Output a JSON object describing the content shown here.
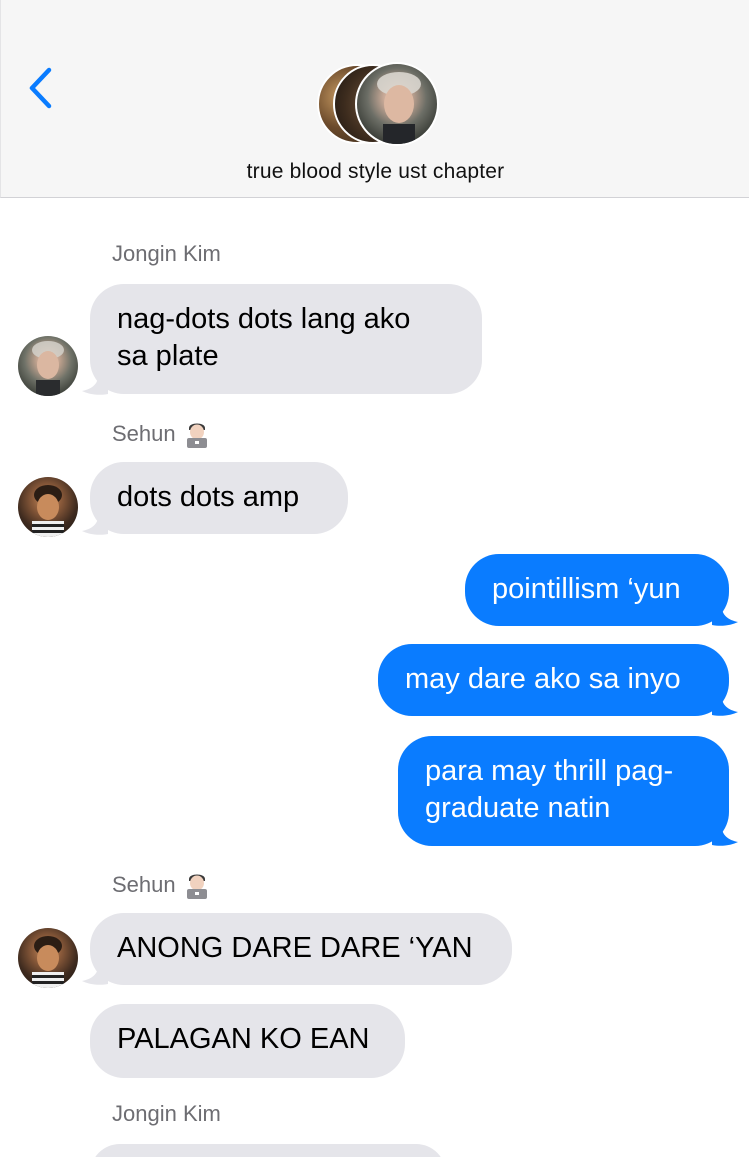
{
  "header": {
    "back_icon": "chevron-left-icon",
    "group_title": "true blood style ust chapter"
  },
  "colors": {
    "accent": "#0a7cff",
    "incoming_bubble": "#e5e5ea",
    "header_bg": "#f6f6f6"
  },
  "messages": [
    {
      "sender": "Jongin Kim",
      "sender_emoji": "",
      "direction": "incoming",
      "text": "nag-dots dots lang ako\nsa plate"
    },
    {
      "sender": "Sehun",
      "sender_emoji": "man-technologist-emoji",
      "direction": "incoming",
      "text": "dots dots amp"
    },
    {
      "sender": "",
      "direction": "outgoing",
      "text": "pointillism ‘yun"
    },
    {
      "sender": "",
      "direction": "outgoing",
      "text": "may dare ako sa inyo"
    },
    {
      "sender": "",
      "direction": "outgoing",
      "text": "para may thrill pag-\ngraduate natin"
    },
    {
      "sender": "Sehun",
      "sender_emoji": "man-technologist-emoji",
      "direction": "incoming",
      "text": "ANONG DARE DARE ‘YAN"
    },
    {
      "sender": "",
      "direction": "incoming",
      "text": "PALAGAN KO EAN"
    },
    {
      "sender": "Jongin Kim",
      "sender_emoji": "",
      "direction": "incoming",
      "text": ""
    }
  ]
}
